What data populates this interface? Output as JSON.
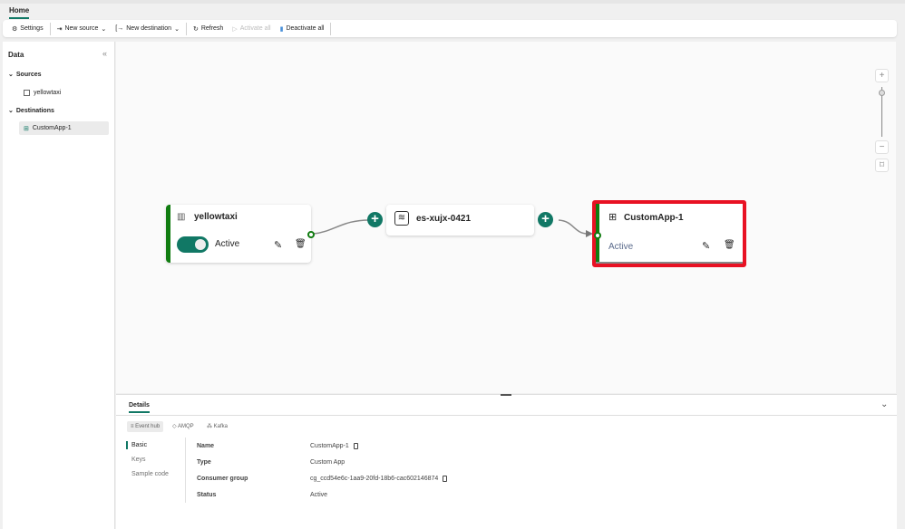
{
  "tabs": {
    "home": "Home"
  },
  "toolbar": {
    "settings": "Settings",
    "new_source": "New source",
    "new_destination": "New destination",
    "refresh": "Refresh",
    "activate_all": "Activate all",
    "deactivate_all": "Deactivate all"
  },
  "sidebar": {
    "title": "Data",
    "sources_label": "Sources",
    "sources": [
      {
        "label": "yellowtaxi"
      }
    ],
    "destinations_label": "Destinations",
    "destinations": [
      {
        "label": "CustomApp-1"
      }
    ]
  },
  "canvas": {
    "source_node": {
      "title": "yellowtaxi",
      "status": "Active",
      "toggle_on": true
    },
    "stream_node": {
      "title": "es-xujx-0421"
    },
    "dest_node": {
      "title": "CustomApp-1",
      "status": "Active"
    },
    "zoom_level_fraction": 0.15
  },
  "details": {
    "tab": "Details",
    "protocols": [
      "Event hub",
      "AMQP",
      "Kafka"
    ],
    "nav": [
      "Basic",
      "Keys",
      "Sample code"
    ],
    "fields": [
      {
        "label": "Name",
        "value": "CustomApp-1"
      },
      {
        "label": "Type",
        "value": "Custom App"
      },
      {
        "label": "Consumer group",
        "value": "cg_ccd54e6c-1aa9-20fd-18b6-cac602146874"
      },
      {
        "label": "Status",
        "value": "Active"
      }
    ]
  },
  "colors": {
    "accent": "#117865",
    "active_bar": "#107c10",
    "selection": "#e81123"
  }
}
